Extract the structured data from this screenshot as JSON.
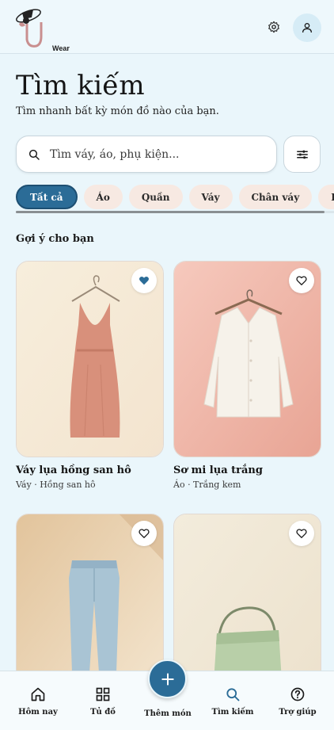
{
  "app": {
    "logo_text": "Wear"
  },
  "header": {
    "settings_icon": "gear-icon",
    "profile_icon": "user-icon"
  },
  "page": {
    "title": "Tìm kiếm",
    "subtitle": "Tìm nhanh bất kỳ món đồ nào của bạn."
  },
  "search": {
    "placeholder": "Tìm váy, áo, phụ kiện...",
    "value": ""
  },
  "filters": {
    "chips": [
      "Tất cả",
      "Áo",
      "Quần",
      "Váy",
      "Chân váy",
      "Phụ kiện"
    ],
    "active_index": 0
  },
  "section": {
    "title": "Gợi ý cho bạn"
  },
  "items": [
    {
      "name": "Váy lụa hồng san hô",
      "meta": "Váy · Hồng san hô",
      "favorited": true
    },
    {
      "name": "Sơ mi lụa trắng",
      "meta": "Áo · Trắng kem",
      "favorited": false
    },
    {
      "name": "",
      "meta": "",
      "favorited": false
    },
    {
      "name": "",
      "meta": "",
      "favorited": false
    }
  ],
  "nav": {
    "items": [
      {
        "label": "Hôm nay",
        "icon": "home-icon"
      },
      {
        "label": "Tủ đồ",
        "icon": "grid-icon"
      },
      {
        "label": "Thêm món",
        "icon": "plus-icon"
      },
      {
        "label": "Tìm kiếm",
        "icon": "search-icon"
      },
      {
        "label": "Trợ giúp",
        "icon": "help-icon"
      }
    ]
  },
  "colors": {
    "accent": "#2b6c97",
    "background": "#eaf6fb",
    "chip": "#f7e9e2"
  }
}
